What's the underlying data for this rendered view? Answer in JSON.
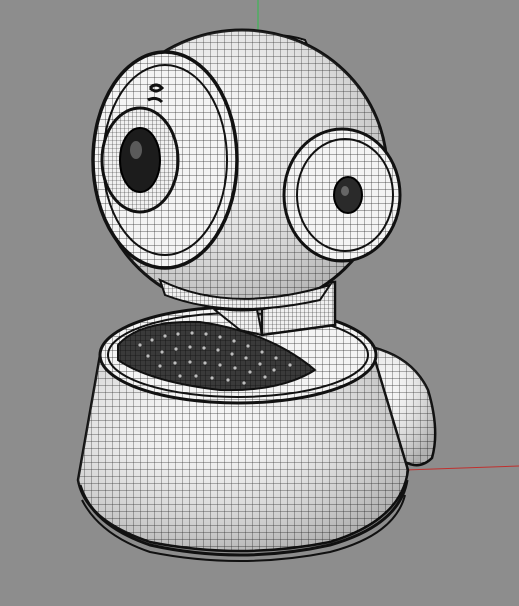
{
  "viewport": {
    "background_color": "#8d8d8d",
    "axis_colors": {
      "y_axis": "#2fbf4a",
      "x_axis": "#c0302e"
    }
  },
  "model": {
    "display_mode": "wireframe-over-shaded",
    "surface_color": "#f2f2f2",
    "wire_color": "#1e1e1e",
    "parts": [
      {
        "name": "camera-head-sphere"
      },
      {
        "name": "front-lens"
      },
      {
        "name": "side-hinge-disc"
      },
      {
        "name": "neck-post"
      },
      {
        "name": "base-dome"
      },
      {
        "name": "base-speaker-grille"
      },
      {
        "name": "base-side-tab"
      }
    ]
  }
}
